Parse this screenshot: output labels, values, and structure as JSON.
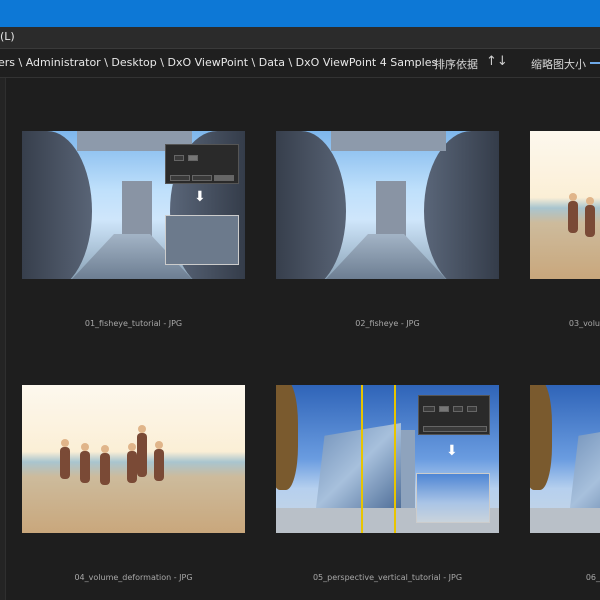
{
  "menu": {
    "label": "(L)"
  },
  "path": {
    "breadcrumb": "ers \\ Administrator \\ Desktop \\ DxO ViewPoint \\ Data \\ DxO ViewPoint 4 Samples",
    "sort_label": "排序依据",
    "sort_icon": "↑↓",
    "thumb_size_label": "缩略图大小"
  },
  "files": [
    {
      "name": "01_fisheye_tutorial - JPG"
    },
    {
      "name": "02_fisheye - JPG"
    },
    {
      "name": "03_volu"
    },
    {
      "name": "04_volume_deformation - JPG"
    },
    {
      "name": "05_perspective_vertical_tutorial - JPG"
    },
    {
      "name": "06_"
    }
  ],
  "colors": {
    "titlebar": "#0d78d6",
    "background": "#1e1e1e",
    "guide_lines": "#e8c400"
  }
}
